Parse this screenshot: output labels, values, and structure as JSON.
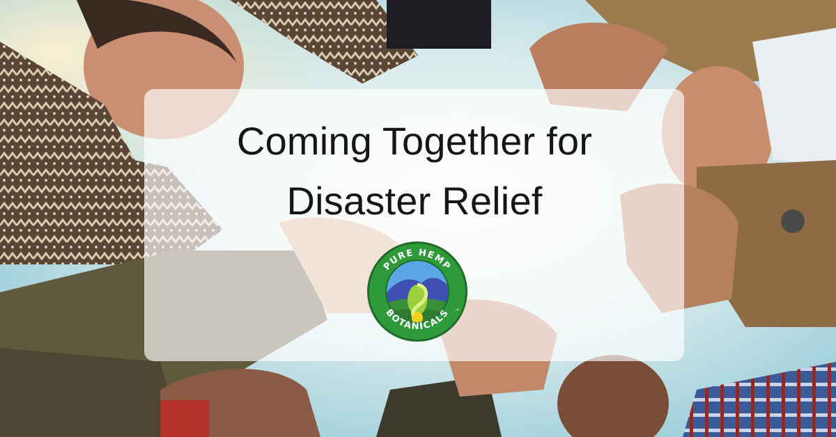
{
  "headline": {
    "line1": "Coming Together for",
    "line2": "Disaster Relief"
  },
  "logo": {
    "top_text": "PURE HEMP",
    "bottom_text": "BOTANICALS",
    "trademark": "™"
  },
  "colors": {
    "sky": "#bcd9e6",
    "panel": "rgba(255,255,255,0.66)",
    "logo_green": "#2f8f3a",
    "logo_yellow": "#f2d21f",
    "logo_blue": "#3d69c9",
    "text": "#161616"
  }
}
